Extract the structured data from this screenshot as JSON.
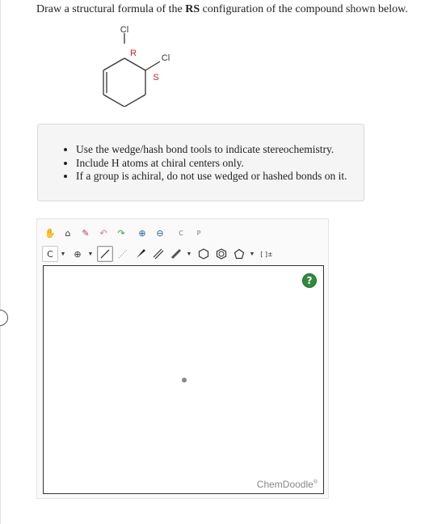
{
  "question": {
    "prefix": "Draw a structural formula of the",
    "emphasis": "RS",
    "suffix": "configuration of the compound shown below."
  },
  "molecule": {
    "atom_label_top": "Cl",
    "atom_label_right": "Cl",
    "stereo_label_1": "R",
    "stereo_label_2": "S",
    "stereo_color": "#cc2222"
  },
  "instructions": [
    "Use the wedge/hash bond tools to indicate stereochemistry.",
    "Include H atoms at chiral centers only.",
    "If a group is achiral, do not use wedged or hashed bonds on it."
  ],
  "toolbar": {
    "row1": [
      {
        "name": "pan-tool-icon",
        "glyph": "✋"
      },
      {
        "name": "lasso-tool-icon",
        "glyph": "⌂"
      },
      {
        "name": "eraser-tool-icon",
        "glyph": "✎"
      },
      {
        "name": "undo-icon",
        "glyph": "↶"
      },
      {
        "name": "redo-icon",
        "glyph": "↷"
      },
      {
        "name": "zoom-in-icon",
        "glyph": "⊕"
      },
      {
        "name": "zoom-out-icon",
        "glyph": "⊖"
      },
      {
        "name": "copy-icon",
        "glyph": "C"
      },
      {
        "name": "paste-icon",
        "glyph": "P"
      }
    ],
    "element_label": "C",
    "charge_label": "⊕",
    "bracket_label": "[ ]±"
  },
  "sketcher": {
    "help_label": "?",
    "brand": "ChemDoodle",
    "brand_mark": "®"
  }
}
